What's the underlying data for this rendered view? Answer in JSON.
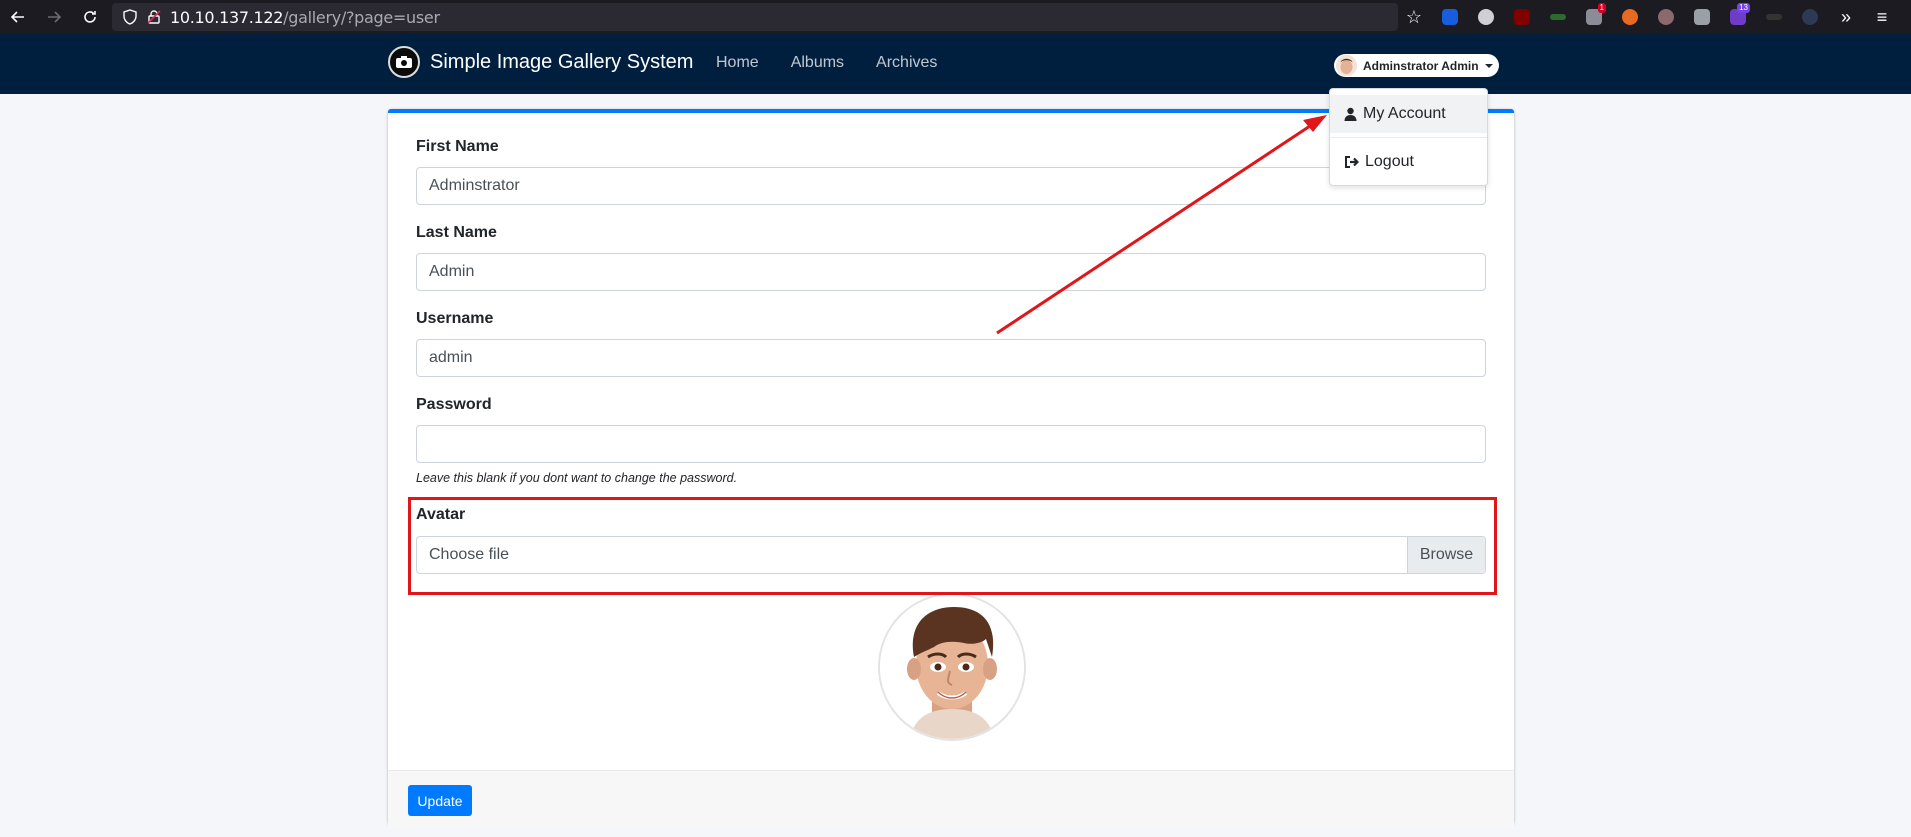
{
  "browser": {
    "url_host": "10.10.137.122",
    "url_path": "/gallery/?page=user",
    "extension_badges": {
      "red": "1",
      "purple": "13"
    }
  },
  "navbar": {
    "brand": "Simple Image Gallery System",
    "links": [
      "Home",
      "Albums",
      "Archives"
    ],
    "user_name": "Adminstrator Admin"
  },
  "dropdown": {
    "my_account": "My Account",
    "logout": "Logout"
  },
  "form": {
    "first_name_label": "First Name",
    "first_name_value": "Adminstrator",
    "last_name_label": "Last Name",
    "last_name_value": "Admin",
    "username_label": "Username",
    "username_value": "admin",
    "password_label": "Password",
    "password_value": "",
    "password_help": "Leave this blank if you dont want to change the password.",
    "avatar_label": "Avatar",
    "file_placeholder": "Choose file",
    "browse_label": "Browse",
    "update_label": "Update"
  },
  "colors": {
    "navbar_bg": "#001f3f",
    "accent": "#007bff",
    "annotation": "#e0161b"
  }
}
